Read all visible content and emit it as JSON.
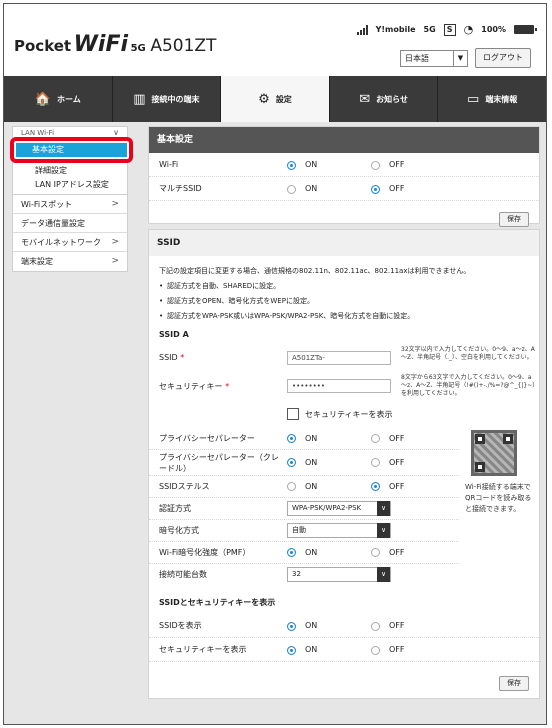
{
  "header": {
    "logo_prefix": "Pocket",
    "logo_wifi": "WiFi",
    "logo_5g": "5G",
    "model": "A501ZT",
    "carrier": "Y!mobile",
    "network": "5G",
    "s_badge": "S",
    "battery": "100%",
    "language": "日本語",
    "logout": "ログアウト"
  },
  "nav": {
    "tabs": [
      {
        "label": "ホーム",
        "icon": "home-icon",
        "glyph": "🏠"
      },
      {
        "label": "接続中の端末",
        "icon": "devices-icon",
        "glyph": "▥"
      },
      {
        "label": "設定",
        "icon": "gear-icon",
        "glyph": "⚙"
      },
      {
        "label": "お知らせ",
        "icon": "mail-icon",
        "glyph": "✉"
      },
      {
        "label": "端末情報",
        "icon": "monitor-icon",
        "glyph": "▭"
      }
    ]
  },
  "sidebar": {
    "lan_wifi": "LAN Wi-Fi",
    "selected": "基本設定",
    "sub": [
      "詳細設定",
      "LAN IPアドレス設定"
    ],
    "items": [
      {
        "label": "Wi-Fiスポット",
        "chev": ">"
      },
      {
        "label": "データ通信量設定",
        "chev": ""
      },
      {
        "label": "モバイルネットワーク",
        "chev": ">"
      },
      {
        "label": "端末設定",
        "chev": ">"
      }
    ]
  },
  "basic": {
    "title": "基本設定",
    "wifi_label": "Wi-Fi",
    "multi_label": "マルチSSID",
    "wifi_value": "ON",
    "multi_value": "OFF",
    "on": "ON",
    "off": "OFF",
    "save": "保存"
  },
  "ssid": {
    "title": "SSID",
    "desc": "下記の設定項目に変更する場合、通信規格の802.11n、802.11ac、802.11axは利用できません。",
    "bullets": [
      "認証方式を自動、SHAREDに設定。",
      "認証方式をOPEN、暗号化方式をWEPに設定。",
      "認証方式をWPA-PSK或いはWPA-PSK/WPA2-PSK、暗号化方式を自動に設定。"
    ],
    "section_a": "SSID A",
    "ssid_label": "SSID",
    "req": "*",
    "ssid_value": "A501ZTa-",
    "ssid_note": "32文字以内で入力してください。0～9、a～z、A～Z、半角記号（._）、空白を利用してください。",
    "key_label": "セキュリティキー",
    "key_value": "••••••••",
    "key_note": "8文字から63文字で入力してください。0～9、a～z、A～Z、半角記号（!#()+-./%=?@^_{|}~）を利用してください。",
    "show_key": "セキュリティキーを表示",
    "privacy_label": "プライバシーセパレーター",
    "privacy_cradle_label": "プライバシーセパレーター（クレードル）",
    "stealth_label": "SSIDステルス",
    "auth_label": "認証方式",
    "auth_value": "WPA-PSK/WPA2-PSK",
    "enc_label": "暗号化方式",
    "enc_value": "自動",
    "pmf_label": "Wi-Fi暗号化強度（PMF）",
    "max_label": "接続可能台数",
    "max_value": "32",
    "qr_text": "Wi-Fi接続する端末でQRコードを読み取ると接続できます。",
    "show_section": "SSIDとセキュリティキーを表示",
    "show_ssid_label": "SSIDを表示",
    "show_key_label": "セキュリティキーを表示",
    "on": "ON",
    "off": "OFF",
    "save": "保存"
  },
  "colors": {
    "accent": "#1aa3d9",
    "highlight": "#e8001d",
    "radio_on": "#1c86d8"
  }
}
